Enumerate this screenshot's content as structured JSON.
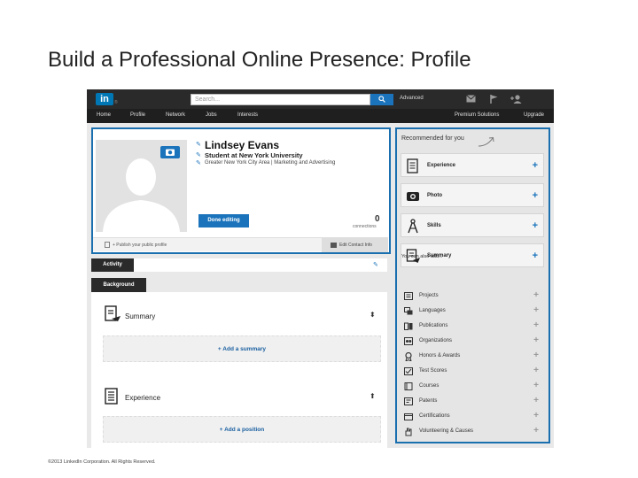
{
  "slide": {
    "title": "Build a Professional Online Presence: Profile",
    "copyright": "©2013 LinkedIn Corporation. All Rights Reserved."
  },
  "topbar": {
    "logo": "in",
    "logo_mark": "®",
    "search_placeholder": "Search...",
    "advanced": "Advanced"
  },
  "nav": {
    "items": [
      "Home",
      "Profile",
      "Network",
      "Jobs",
      "Interests"
    ],
    "premium": "Premium Solutions",
    "upgrade": "Upgrade"
  },
  "profile": {
    "name": "Lindsey Evans",
    "headline": "Student at New York University",
    "location": "Greater New York City Area  |  Marketing and Advertising",
    "done_button": "Done editing",
    "connections_count": "0",
    "connections_label": "connections",
    "publish_link": "+ Publish your public profile",
    "contact_info": "Edit Contact Info"
  },
  "sections": {
    "activity": "Activity",
    "background": "Background",
    "summary": "Summary",
    "add_summary": "+ Add a summary",
    "experience": "Experience",
    "add_position": "+ Add a position"
  },
  "recommended": {
    "title": "Recommended for you",
    "items": [
      {
        "label": "Experience",
        "icon": "experience-icon"
      },
      {
        "label": "Photo",
        "icon": "camera-icon"
      },
      {
        "label": "Skills",
        "icon": "skills-icon"
      },
      {
        "label": "Summary",
        "icon": "summary-icon"
      }
    ],
    "also_title": "You can also add...",
    "also_items": [
      "Projects",
      "Languages",
      "Publications",
      "Organizations",
      "Honors & Awards",
      "Test Scores",
      "Courses",
      "Patents",
      "Certifications",
      "Volunteering & Causes"
    ]
  },
  "colors": {
    "linkedin_blue": "#0077b5",
    "highlight_border": "#1a6faf",
    "topbar": "#2a2a2a"
  }
}
